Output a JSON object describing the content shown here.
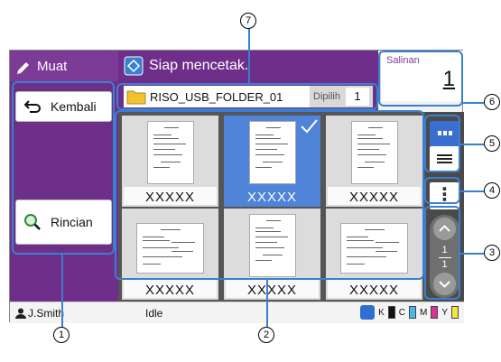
{
  "mode_tab": {
    "label": "Muat",
    "icon": "pen-icon"
  },
  "header": {
    "status": "Siap mencetak.",
    "icon": "printer-icon"
  },
  "copies": {
    "label": "Salinan",
    "value": "1"
  },
  "back_button": {
    "label": "Kembali",
    "icon": "return-arrow-icon"
  },
  "detail_button": {
    "label": "Rincian",
    "icon": "magnifier-icon"
  },
  "folder": {
    "name": "RISO_USB_FOLDER_01",
    "selected_label": "Dipilih",
    "selected_count": "1"
  },
  "thumbnails": [
    {
      "caption": "XXXXX",
      "orientation": "portrait",
      "selected": false
    },
    {
      "caption": "XXXXX",
      "orientation": "portrait",
      "selected": true
    },
    {
      "caption": "XXXXX",
      "orientation": "portrait",
      "selected": false
    },
    {
      "caption": "XXXXX",
      "orientation": "landscape",
      "selected": false
    },
    {
      "caption": "XXXXX",
      "orientation": "portrait",
      "selected": false
    },
    {
      "caption": "XXXXX",
      "orientation": "landscape",
      "selected": false
    }
  ],
  "pager": {
    "current": "1",
    "total": "1"
  },
  "status_bar": {
    "user": "J.Smith",
    "state": "Idle",
    "inks": [
      "K",
      "C",
      "M",
      "Y"
    ]
  },
  "callouts": [
    "1",
    "2",
    "3",
    "4",
    "5",
    "6",
    "7"
  ],
  "colors": {
    "accent": "#6e2f8a",
    "selected": "#4f84d8",
    "callout_line": "#3a7fd0",
    "ink_k": "#111111",
    "ink_c": "#48b8e8",
    "ink_m": "#d8329a",
    "ink_y": "#f2e640"
  }
}
